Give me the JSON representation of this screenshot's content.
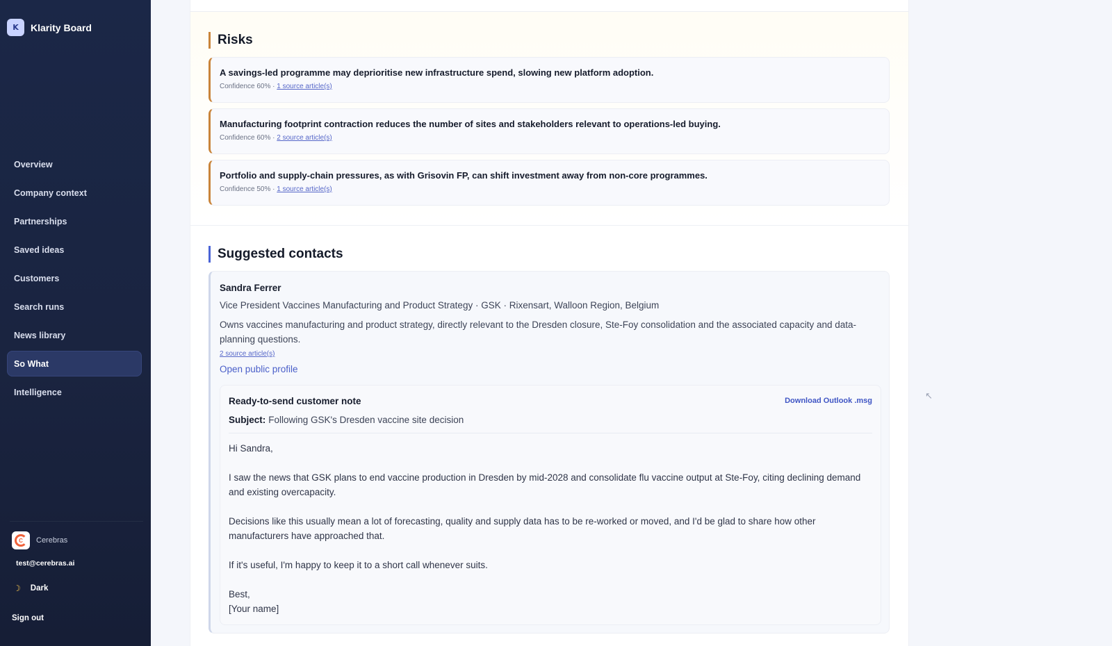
{
  "app": {
    "brand_initial": "K",
    "brand_name": "Klarity Board"
  },
  "sidebar": {
    "items": [
      {
        "label": "Overview"
      },
      {
        "label": "Company context"
      },
      {
        "label": "Partnerships"
      },
      {
        "label": "Saved ideas"
      },
      {
        "label": "Customers"
      },
      {
        "label": "Search runs"
      },
      {
        "label": "News library"
      },
      {
        "label": "So What",
        "active": true
      },
      {
        "label": "Intelligence"
      }
    ],
    "org_name": "Cerebras",
    "org_logo_letter": "C",
    "user_email": "test@cerebras.ai",
    "theme_label": "Dark",
    "theme_icon": "moon-icon",
    "sign_out_label": "Sign out"
  },
  "risks": {
    "title": "Risks",
    "items": [
      {
        "text": "A savings-led programme may deprioritise new infrastructure spend, slowing new platform adoption.",
        "confidence": "Confidence 60% ·",
        "sources": "1 source article(s)"
      },
      {
        "text": "Manufacturing footprint contraction reduces the number of sites and stakeholders relevant to operations-led buying.",
        "confidence": "Confidence 60% ·",
        "sources": "2 source article(s)"
      },
      {
        "text": "Portfolio and supply-chain pressures, as with Grisovin FP, can shift investment away from non-core programmes.",
        "confidence": "Confidence 50% ·",
        "sources": "1 source article(s)"
      }
    ]
  },
  "contacts": {
    "title": "Suggested contacts",
    "items": [
      {
        "name": "Sandra Ferrer",
        "role": "Vice President Vaccines Manufacturing and Product Strategy · GSK · Rixensart, Walloon Region, Belgium",
        "description": "Owns vaccines manufacturing and product strategy, directly relevant to the Dresden closure, Ste-Foy consolidation and the associated capacity and data-planning questions.",
        "sources": "2 source article(s)",
        "profile_link": "Open public profile",
        "note": {
          "heading": "Ready-to-send customer note",
          "download_label": "Download Outlook .msg",
          "subject_label": "Subject:",
          "subject": "Following GSK's Dresden vaccine site decision",
          "greeting": "Hi Sandra,",
          "paragraph1": "I saw the news that GSK plans to end vaccine production in Dresden by mid-2028 and consolidate flu vaccine output at Ste-Foy, citing declining demand and existing overcapacity.",
          "paragraph2": "Decisions like this usually mean a lot of forecasting, quality and supply data has to be re-worked or moved, and I'd be glad to share how other manufacturers have approached that.",
          "paragraph3": "If it's useful, I'm happy to keep it to a short call whenever suits.",
          "signoff": "Best,",
          "signature": "[Your name]"
        }
      }
    ]
  },
  "colors": {
    "sidebar_bg": "#1a2440",
    "risk_accent": "#c9843a",
    "contacts_accent": "#4a63d6",
    "link": "#5566c8"
  }
}
